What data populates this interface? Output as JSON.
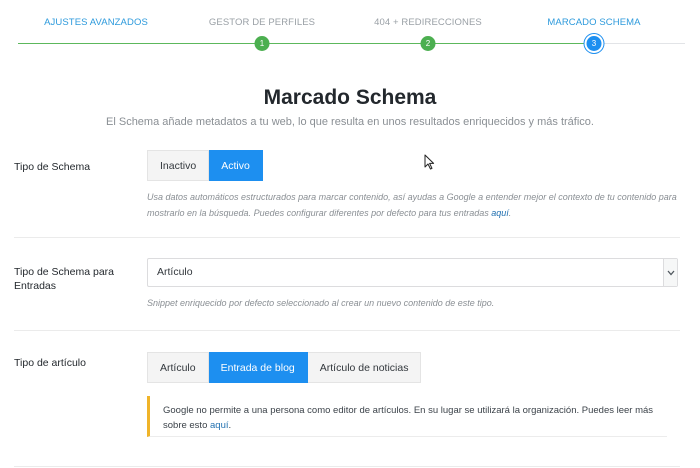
{
  "stepper": {
    "steps": [
      {
        "label": "AJUSTES AVANZADOS",
        "state": "active"
      },
      {
        "label": "GESTOR DE PERFILES",
        "number": "1",
        "state": "done"
      },
      {
        "label": "404 + REDIRECCIONES",
        "number": "2",
        "state": "done"
      },
      {
        "label": "MARCADO SCHEMA",
        "number": "3",
        "state": "current"
      }
    ]
  },
  "header": {
    "title": "Marcado Schema",
    "subtitle": "El Schema añade metadatos a tu web, lo que resulta en unos resultados enriquecidos y más tráfico."
  },
  "schema_type": {
    "label": "Tipo de Schema",
    "options": [
      "Inactivo",
      "Activo"
    ],
    "selected": "Activo",
    "description": "Usa datos automáticos estructurados para marcar contenido, así ayudas a Google a entender mejor el contexto de tu contenido para mostrarlo en la búsqueda. Puedes configurar diferentes por defecto para tus entradas ",
    "description_link": "aquí",
    "description_end": "."
  },
  "posts_schema": {
    "label_line1": "Tipo de Schema para",
    "label_line2": "Entradas",
    "value": "Artículo",
    "description": "Snippet enriquecido por defecto seleccionado al crear un nuevo contenido de este tipo."
  },
  "article_type": {
    "label": "Tipo de artículo",
    "options": [
      "Artículo",
      "Entrada de blog",
      "Artículo de noticias"
    ],
    "selected": "Entrada de blog",
    "notice": "Google no permite a una persona como editor de artículos. En su lugar se utilizará la organización. Puedes leer más sobre esto ",
    "notice_link": "aquí",
    "notice_end": "."
  },
  "colors": {
    "accent": "#1d8ff0",
    "done": "#4caf50",
    "notice_border": "#f0b429"
  }
}
